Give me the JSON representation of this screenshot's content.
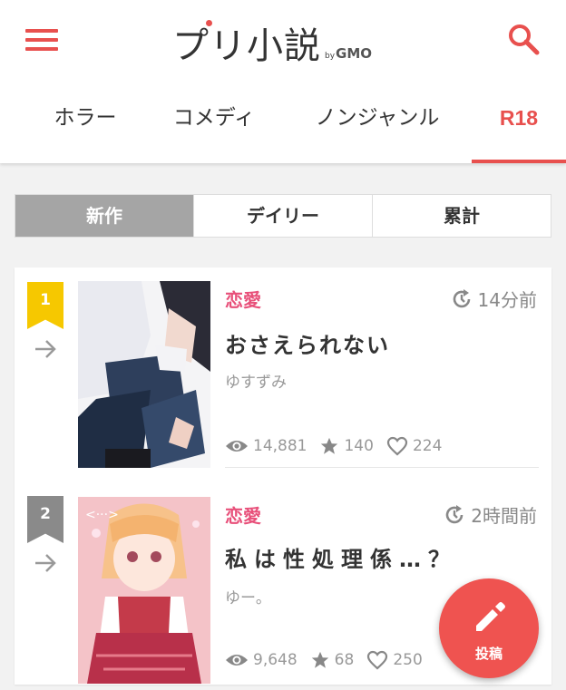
{
  "app": {
    "logo_text": "プリ小説",
    "logo_by": "by",
    "logo_brand": "GMO"
  },
  "colors": {
    "accent": "#e8504e",
    "genre": "#e8507a",
    "rank1": "#f6c800",
    "rank2": "#8a8a8a",
    "fab": "#ef5350"
  },
  "icons": {
    "menu": "hamburger-icon",
    "search": "search-icon",
    "clock": "history-clock-icon",
    "eye": "eye-icon",
    "star": "star-icon",
    "heart": "heart-outline-icon",
    "arrow": "arrow-right-icon",
    "pencil": "pencil-icon"
  },
  "genre_tabs": [
    {
      "label": "ホラー",
      "active": false
    },
    {
      "label": "コメディ",
      "active": false
    },
    {
      "label": "ノンジャンル",
      "active": false
    },
    {
      "label": "R18",
      "active": true
    }
  ],
  "sort_tabs": [
    {
      "label": "新作",
      "active": true
    },
    {
      "label": "デイリー",
      "active": false
    },
    {
      "label": "累計",
      "active": false
    }
  ],
  "ranking": [
    {
      "rank": "1",
      "genre": "恋愛",
      "time": "14分前",
      "title": "おさえられない",
      "author": "ゆすずみ",
      "views": "14,881",
      "stars": "140",
      "likes": "224"
    },
    {
      "rank": "2",
      "genre": "恋愛",
      "time": "2時間前",
      "title": "私は性処理係…？",
      "author": "ゆー。",
      "views": "9,648",
      "stars": "68",
      "likes": "250"
    }
  ],
  "fab": {
    "label": "投稿"
  }
}
